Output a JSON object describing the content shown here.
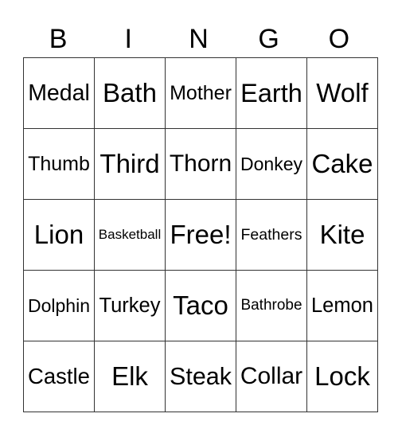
{
  "header": [
    "B",
    "I",
    "N",
    "G",
    "O"
  ],
  "rows": [
    [
      "Medal",
      "Bath",
      "Mother",
      "Earth",
      "Wolf"
    ],
    [
      "Thumb",
      "Third",
      "Thorn",
      "Donkey",
      "Cake"
    ],
    [
      "Lion",
      "Basketball",
      "Free!",
      "Feathers",
      "Kite"
    ],
    [
      "Dolphin",
      "Turkey",
      "Taco",
      "Bathrobe",
      "Lemon"
    ],
    [
      "Castle",
      "Elk",
      "Steak",
      "Collar",
      "Lock"
    ]
  ]
}
